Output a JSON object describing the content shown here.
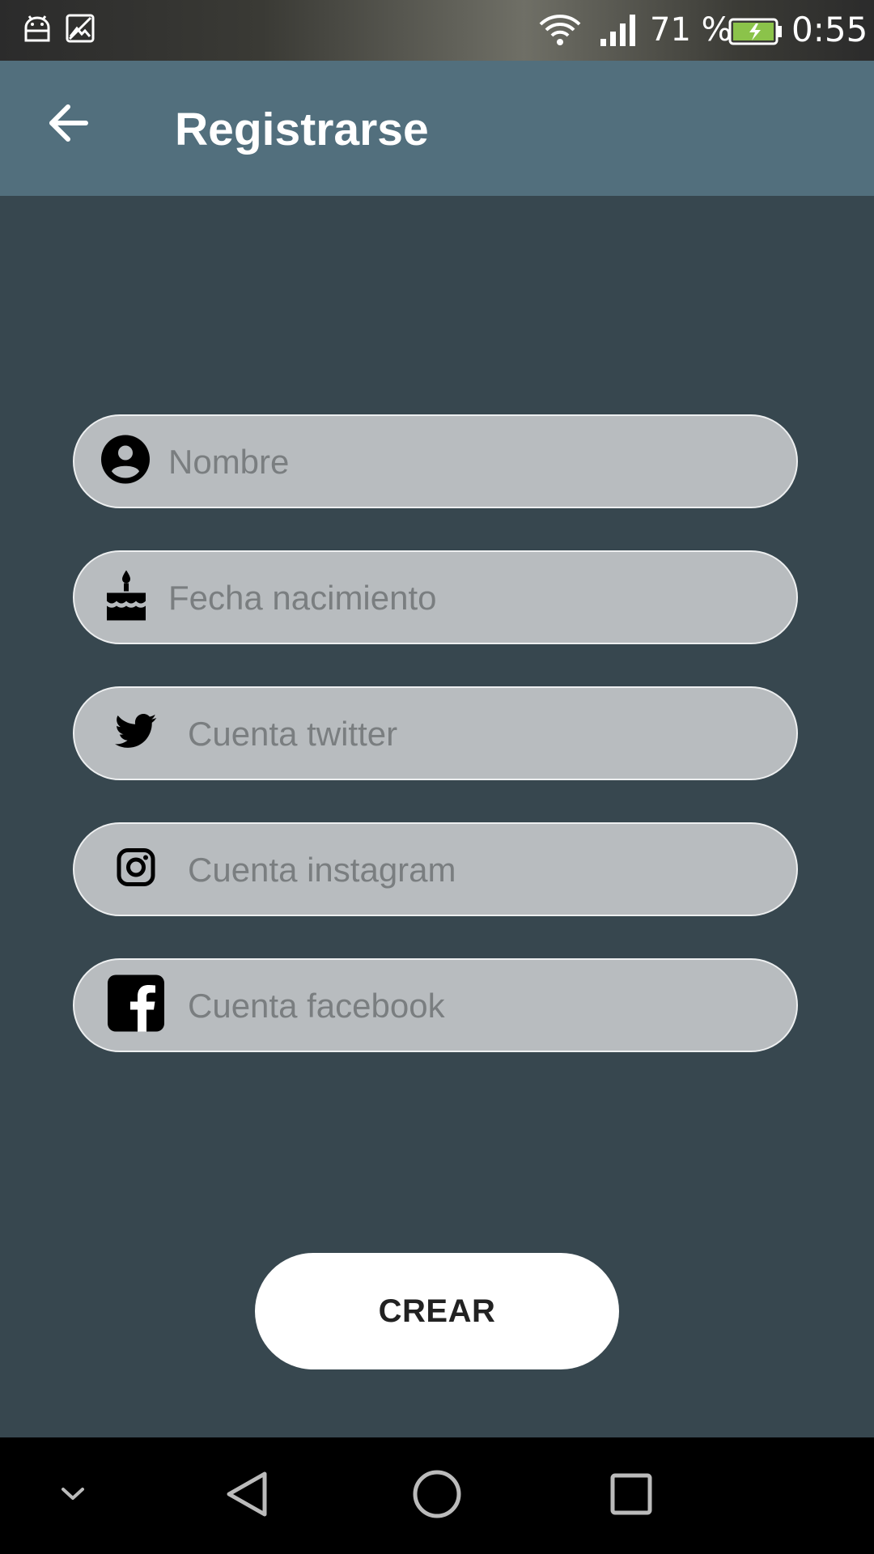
{
  "status_bar": {
    "battery_percent": "71 %",
    "time": "0:55",
    "icons": [
      "android-debug-icon",
      "image-icon",
      "wifi-icon",
      "cell-signal-icon",
      "battery-charging-icon"
    ]
  },
  "app_bar": {
    "title": "Registrarse",
    "back_icon": "arrow-back-icon"
  },
  "form": {
    "fields": [
      {
        "placeholder": "Nombre",
        "value": "",
        "icon": "account-circle-icon"
      },
      {
        "placeholder": "Fecha nacimiento",
        "value": "",
        "icon": "cake-icon"
      },
      {
        "placeholder": "Cuenta twitter",
        "value": "",
        "icon": "twitter-icon"
      },
      {
        "placeholder": "Cuenta instagram",
        "value": "",
        "icon": "instagram-icon"
      },
      {
        "placeholder": "Cuenta facebook",
        "value": "",
        "icon": "facebook-icon"
      }
    ],
    "submit_label": "CREAR"
  },
  "nav_bar": {
    "icons": [
      "chevron-down-icon",
      "nav-back-icon",
      "nav-home-icon",
      "nav-recents-icon"
    ]
  },
  "colors": {
    "status_bar": "#3a3a35",
    "app_bar": "#526F7D",
    "background": "#37474F",
    "field_fill": "#B8BCBF",
    "field_border": "#EDEFF0",
    "placeholder": "#7A7E80",
    "button": "#FFFFFF",
    "battery_fill": "#8BC34A"
  }
}
